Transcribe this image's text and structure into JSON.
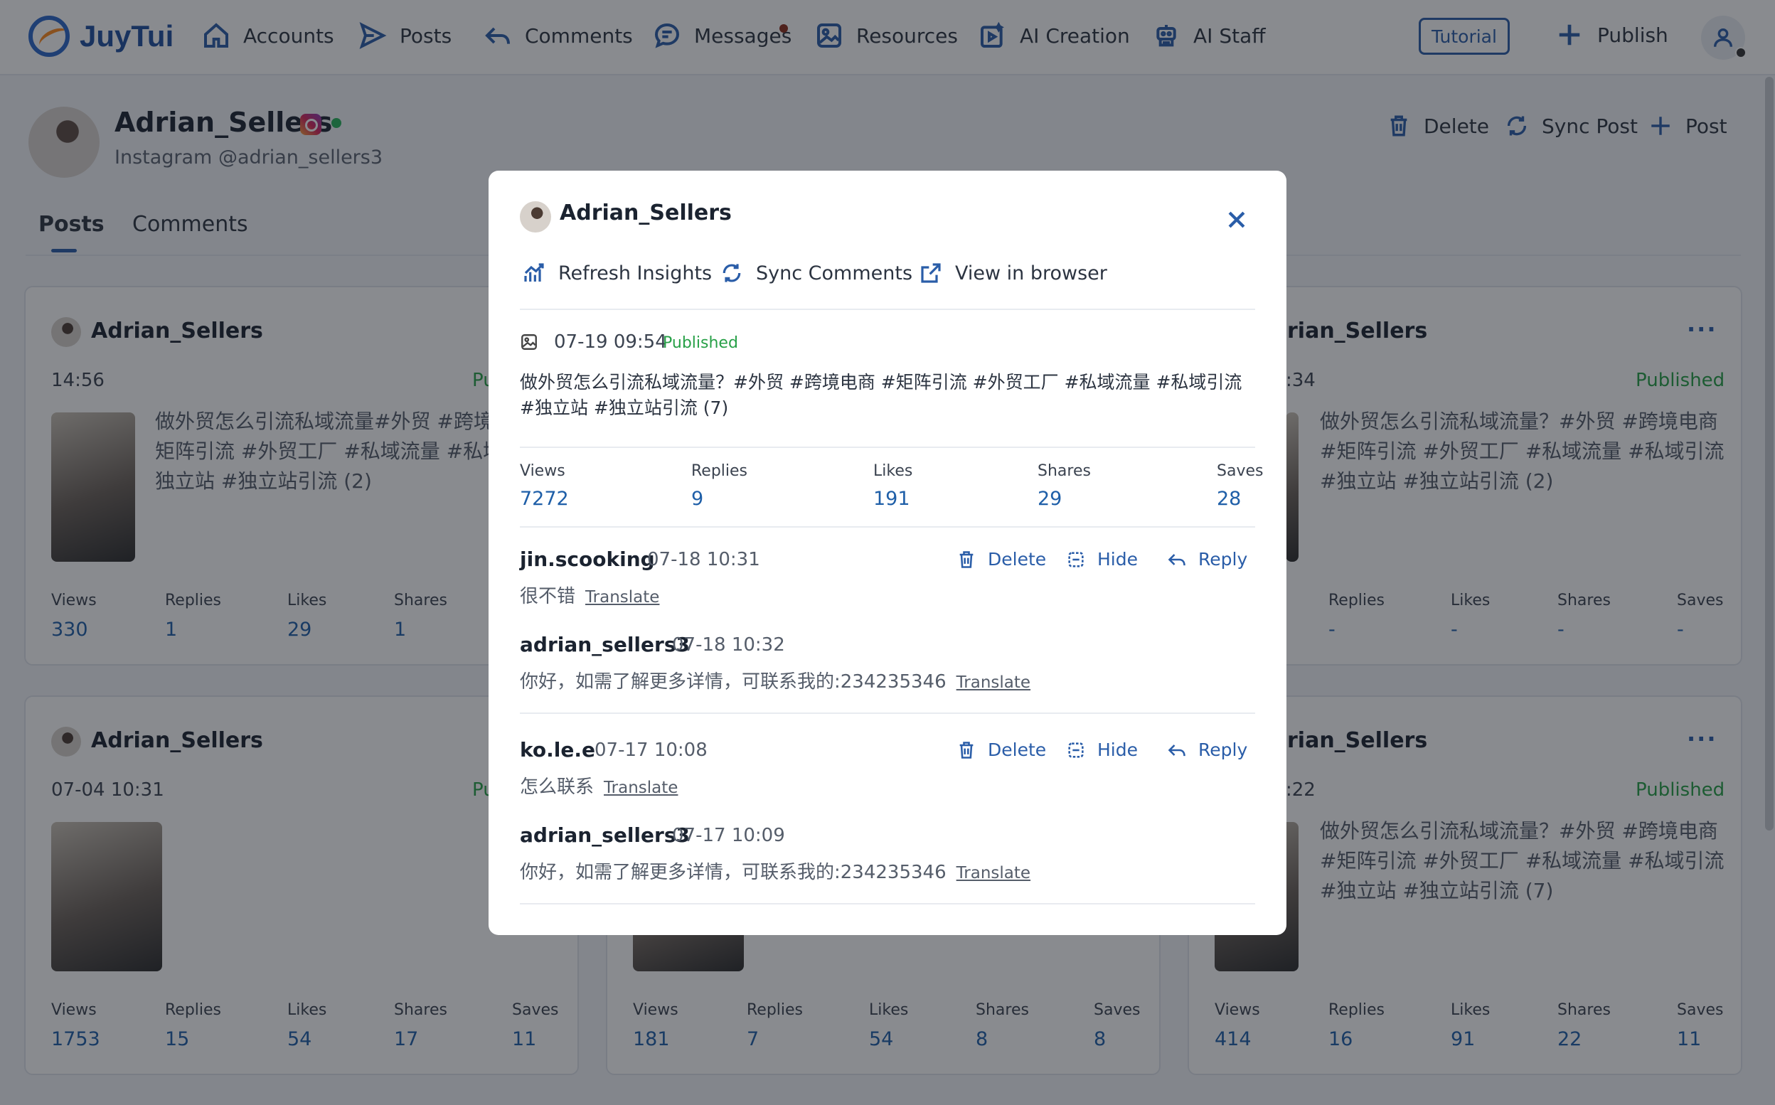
{
  "app": {
    "name": "JuyTui"
  },
  "nav": {
    "items": [
      {
        "label": "Accounts"
      },
      {
        "label": "Posts"
      },
      {
        "label": "Comments"
      },
      {
        "label": "Messages"
      },
      {
        "label": "Resources"
      },
      {
        "label": "AI Creation"
      },
      {
        "label": "AI Staff"
      }
    ],
    "tutorial": "Tutorial",
    "publish": "Publish"
  },
  "profile": {
    "name": "Adrian_Sellers",
    "handle": "Instagram @adrian_sellers3",
    "actions": {
      "delete": "Delete",
      "sync": "Sync Post",
      "post": "Post"
    },
    "tabs": [
      "Posts",
      "Comments"
    ]
  },
  "stat_labels": {
    "views": "Views",
    "replies": "Replies",
    "likes": "Likes",
    "shares": "Shares",
    "saves": "Saves"
  },
  "cards": [
    {
      "name": "Adrian_Sellers",
      "time": "14:56",
      "status": "Pu",
      "text": "做外贸怎么引流私域流量#外贸 #跨境电\n矩阵引流 #外贸工厂 #私域流量 #私域\n独立站 #独立站引流 (2)",
      "views": "330",
      "replies": "1",
      "likes": "29",
      "shares": "1"
    },
    {
      "name": "rian_Sellers",
      "time": ":34",
      "status": "Published",
      "more": "···",
      "text": "做外贸怎么引流私域流量？#外贸 #跨境电商\n#矩阵引流 #外贸工厂 #私域流量 #私域引流\n#独立站 #独立站引流 (2)",
      "replies": "-",
      "likes": "-",
      "shares": "-",
      "saves": "-"
    },
    {
      "name": "Adrian_Sellers",
      "time": "07-04 10:31",
      "status": "Pu",
      "views": "1753",
      "replies": "15",
      "likes": "54",
      "shares": "17",
      "saves": "11"
    },
    {
      "views": "181",
      "replies": "7",
      "likes": "54",
      "shares": "8",
      "saves": "8"
    },
    {
      "name": "rian_Sellers",
      "time": ":22",
      "status": "Published",
      "more": "···",
      "text": "做外贸怎么引流私域流量？#外贸 #跨境电商\n#矩阵引流 #外贸工厂 #私域流量 #私域引流\n#独立站 #独立站引流 (7)",
      "views": "414",
      "replies": "16",
      "likes": "91",
      "shares": "22",
      "saves": "11"
    }
  ],
  "modal": {
    "title": "Adrian_Sellers",
    "actions": {
      "refresh": "Refresh Insights",
      "sync": "Sync Comments",
      "view": "View in browser"
    },
    "post": {
      "time": "07-19 09:54",
      "status": "Published",
      "text": "做外贸怎么引流私域流量？#外贸 #跨境电商 #矩阵引流 #外贸工厂 #私域流量 #私域引流 #独立站 #独立站引流 (7)"
    },
    "stats": {
      "views": "7272",
      "replies": "9",
      "likes": "191",
      "shares": "29",
      "saves": "28"
    },
    "comment_actions": {
      "delete": "Delete",
      "hide": "Hide",
      "reply": "Reply",
      "translate": "Translate"
    },
    "comments": [
      {
        "user": "jin.scooking",
        "time": "07-18 10:31",
        "text": "很不错",
        "reply": {
          "user": "adrian_sellers3",
          "time": "07-18 10:32",
          "text": "你好，如需了解更多详情，可联系我的:234235346"
        }
      },
      {
        "user": "ko.le.e",
        "time": "07-17 10:08",
        "text": "怎么联系",
        "reply": {
          "user": "adrian_sellers3",
          "time": "07-17 10:09",
          "text": "你好，如需了解更多详情，可联系我的:234235346"
        }
      }
    ]
  }
}
